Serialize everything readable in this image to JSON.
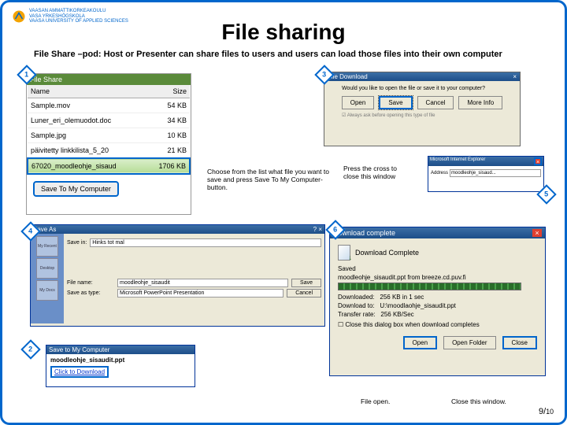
{
  "logo": {
    "line1": "VAASAN AMMATTIKORKEAKOULU",
    "line2": "VASA YRKESHÖGSKOLA",
    "line3": "VAASA UNIVERSITY OF APPLIED SCIENCES"
  },
  "page": {
    "title": "File sharing",
    "subtitle": "File Share –pod: Host or Presenter can share files to users and users can load those files into their own computer",
    "annotation_choose": "Choose from the list what file you want to save and press Save To My Computer-button.",
    "annotation_cross": "Press the cross to close this window",
    "file_open": "File open.",
    "close_window": "Close this window.",
    "page_num": "9",
    "page_total": "10"
  },
  "callouts": {
    "c1": "1",
    "c2": "2",
    "c3": "3",
    "c4": "4",
    "c5": "5",
    "c6": "6"
  },
  "fileshare": {
    "title": "File Share",
    "col_name": "Name",
    "col_size": "Size",
    "rows": [
      {
        "name": "Sample.mov",
        "size": "54 KB"
      },
      {
        "name": "Luner_eri_olemuodot.doc",
        "size": "34 KB"
      },
      {
        "name": "Sample.jpg",
        "size": "10 KB"
      },
      {
        "name": "päivitetty linkkilista_5_20",
        "size": "21 KB"
      },
      {
        "name": "67020_moodleohje_sisaud",
        "size": "1706 KB"
      }
    ],
    "save_btn": "Save To My Computer"
  },
  "dl": {
    "title": "File Download",
    "question": "Would you like to open the file or save it to your computer?",
    "open": "Open",
    "save": "Save",
    "cancel": "Cancel",
    "more": "More Info",
    "chk": "Always ask before opening this type of file"
  },
  "ie": {
    "title": "Microsoft Internet Explorer",
    "url": "moodleohje_sisaud..."
  },
  "dlc": {
    "title": "Download complete",
    "done": "Download Complete",
    "saved": "Saved",
    "file": "moodleohje_sisaudit.ppt from breeze.cd.puv.fi",
    "downloaded_l": "Downloaded:",
    "downloaded_v": "256 KB in 1 sec",
    "to_l": "Download to:",
    "to_v": "U:\\moodlaohje_sisaudit.ppt",
    "rate_l": "Transfer rate:",
    "rate_v": "256 KB/Sec",
    "chk": "Close this dialog box when download completes",
    "open": "Open",
    "openf": "Open Folder",
    "close": "Close"
  },
  "saveas": {
    "title": "Save As",
    "lookin_l": "Save in:",
    "lookin_v": "Hinks tot mal",
    "name_l": "File name:",
    "name_v": "moodleohje_sisaudit",
    "type_l": "Save as type:",
    "type_v": "Microsoft PowerPoint Presentation",
    "save": "Save",
    "cancel": "Cancel",
    "icons": [
      "My Recent",
      "Desktop",
      "My Docs"
    ]
  },
  "stmc": {
    "title": "Save to My Computer",
    "fname": "moodleohje_sisaudit.ppt",
    "link": "Click to Download"
  }
}
